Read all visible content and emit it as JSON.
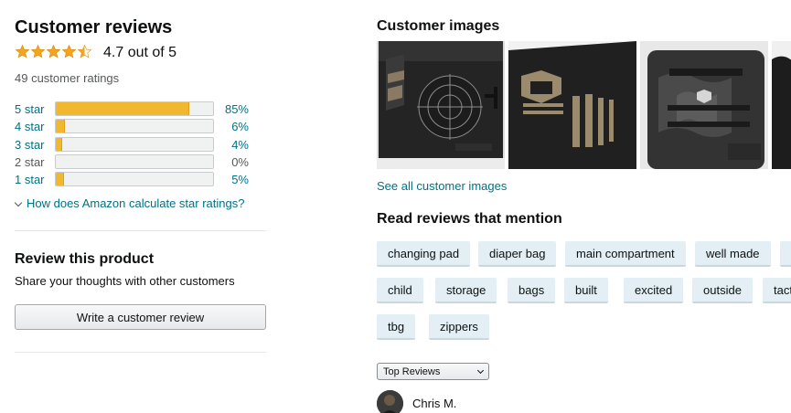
{
  "summary": {
    "title": "Customer reviews",
    "rating_value": 4.7,
    "rating_text": "4.7 out of 5",
    "ratings_count": "49 customer ratings",
    "histogram": [
      {
        "label": "5 star",
        "percent": 85,
        "percent_text": "85%",
        "enabled": true
      },
      {
        "label": "4 star",
        "percent": 6,
        "percent_text": "6%",
        "enabled": true
      },
      {
        "label": "3 star",
        "percent": 4,
        "percent_text": "4%",
        "enabled": true
      },
      {
        "label": "2 star",
        "percent": 0,
        "percent_text": "0%",
        "enabled": false
      },
      {
        "label": "1 star",
        "percent": 5,
        "percent_text": "5%",
        "enabled": true
      }
    ],
    "calc_link": "How does Amazon calculate star ratings?"
  },
  "review_product": {
    "title": "Review this product",
    "subtitle": "Share your thoughts with other customers",
    "button": "Write a customer review"
  },
  "images": {
    "title": "Customer images",
    "see_all": "See all customer images"
  },
  "mentions": {
    "title": "Read reviews that mention",
    "tags": [
      "changing pad",
      "diaper bag",
      "main compartment",
      "well made",
      "",
      "child",
      "storage",
      "bags",
      "built",
      "excited",
      "outside",
      "tact",
      "tbg",
      "zippers"
    ]
  },
  "sort": {
    "selected": "Top Reviews"
  },
  "first_review": {
    "author": "Chris M."
  },
  "colors": {
    "link": "#007185",
    "bar_fill": "#f0b72f",
    "star": "#f4a41d",
    "tag_bg": "#e3eff4"
  }
}
